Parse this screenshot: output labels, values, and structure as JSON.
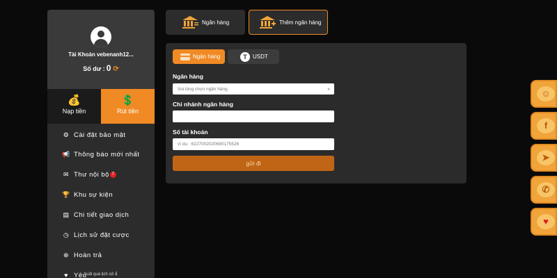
{
  "profile": {
    "account_label": "Tài Khoản vebenanh12...",
    "balance_label": "Số dư :",
    "balance_value": "0"
  },
  "actions": {
    "deposit": "Nạp tiền",
    "withdraw": "Rút tiền"
  },
  "menu": [
    {
      "icon": "user-gear-icon",
      "glyph": "⚙",
      "label": "Cài đặt bảo mật"
    },
    {
      "icon": "megaphone-icon",
      "glyph": "📢",
      "label": "Thông báo mới nhất"
    },
    {
      "icon": "envelope-icon",
      "glyph": "✉",
      "label": "Thư nội bộ",
      "badge": "7"
    },
    {
      "icon": "trophy-icon",
      "glyph": "🏆",
      "label": "Khu sự kiện"
    },
    {
      "icon": "clipboard-icon",
      "glyph": "▤",
      "label": "Chi tiết giao dịch"
    },
    {
      "icon": "clock-icon",
      "glyph": "◷",
      "label": "Lịch sử đặt cược"
    },
    {
      "icon": "refund-icon",
      "glyph": "⊕",
      "label": "Hoàn trả"
    },
    {
      "icon": "heart-icon",
      "glyph": "♥",
      "label": "Yêu"
    }
  ],
  "tooltip": "Xuất quá lịch sử ẩ",
  "tabs": {
    "bank": "Ngân hàng",
    "add_bank": "Thêm ngân hàng"
  },
  "subtabs": {
    "bank": "Ngân hàng",
    "usdt": "USDT"
  },
  "form": {
    "bank_label": "Ngân hàng",
    "bank_select": "Vui lòng chọn ngân hàng",
    "branch_label": "Chi nhánh ngân hàng",
    "branch_value": "",
    "account_label": "Số tài khoản",
    "account_placeholder": "ví dụ : 6227002020690175526",
    "submit": "gửi đi"
  },
  "side_icons": [
    "support-agent-icon",
    "facebook-icon",
    "telegram-icon",
    "phone-icon",
    "heart-hand-icon"
  ],
  "colors": {
    "accent": "#f08a24",
    "panel": "#2b2b2b",
    "background": "#0a0a0a"
  }
}
